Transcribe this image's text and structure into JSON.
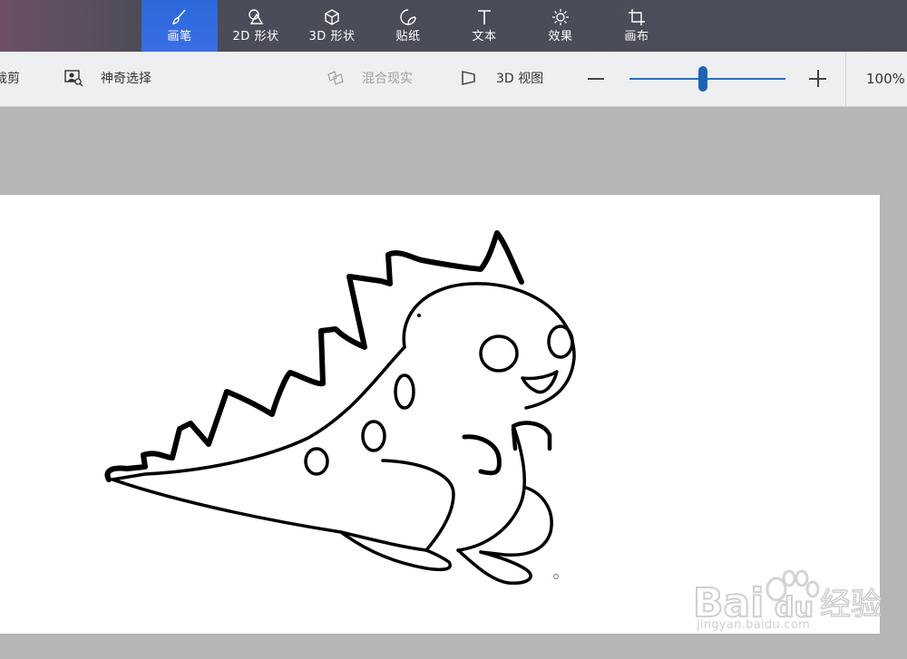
{
  "tabs": [
    {
      "label": "画笔",
      "icon": "brush-icon",
      "active": true
    },
    {
      "label": "2D 形状",
      "icon": "shapes-2d-icon"
    },
    {
      "label": "3D 形状",
      "icon": "cube-icon"
    },
    {
      "label": "贴纸",
      "icon": "sticker-icon"
    },
    {
      "label": "文本",
      "icon": "text-icon"
    },
    {
      "label": "效果",
      "icon": "sun-icon"
    },
    {
      "label": "画布",
      "icon": "canvas-crop-icon"
    }
  ],
  "toolbar": {
    "crop_label": "裁剪",
    "magic_select_label": "神奇选择",
    "mixed_reality_label": "混合现实",
    "view3d_label": "3D 视图",
    "zoom_value": "100%",
    "zoom_level": 0.47
  },
  "watermark": {
    "brand_left": "Bai",
    "brand_right": "du",
    "brand_cn": "经验",
    "url": "jingyan.baidu.com"
  },
  "colors": {
    "active_tab": "#2f6ae0",
    "slider_accent": "#1d63b8",
    "ink": "#000000"
  }
}
